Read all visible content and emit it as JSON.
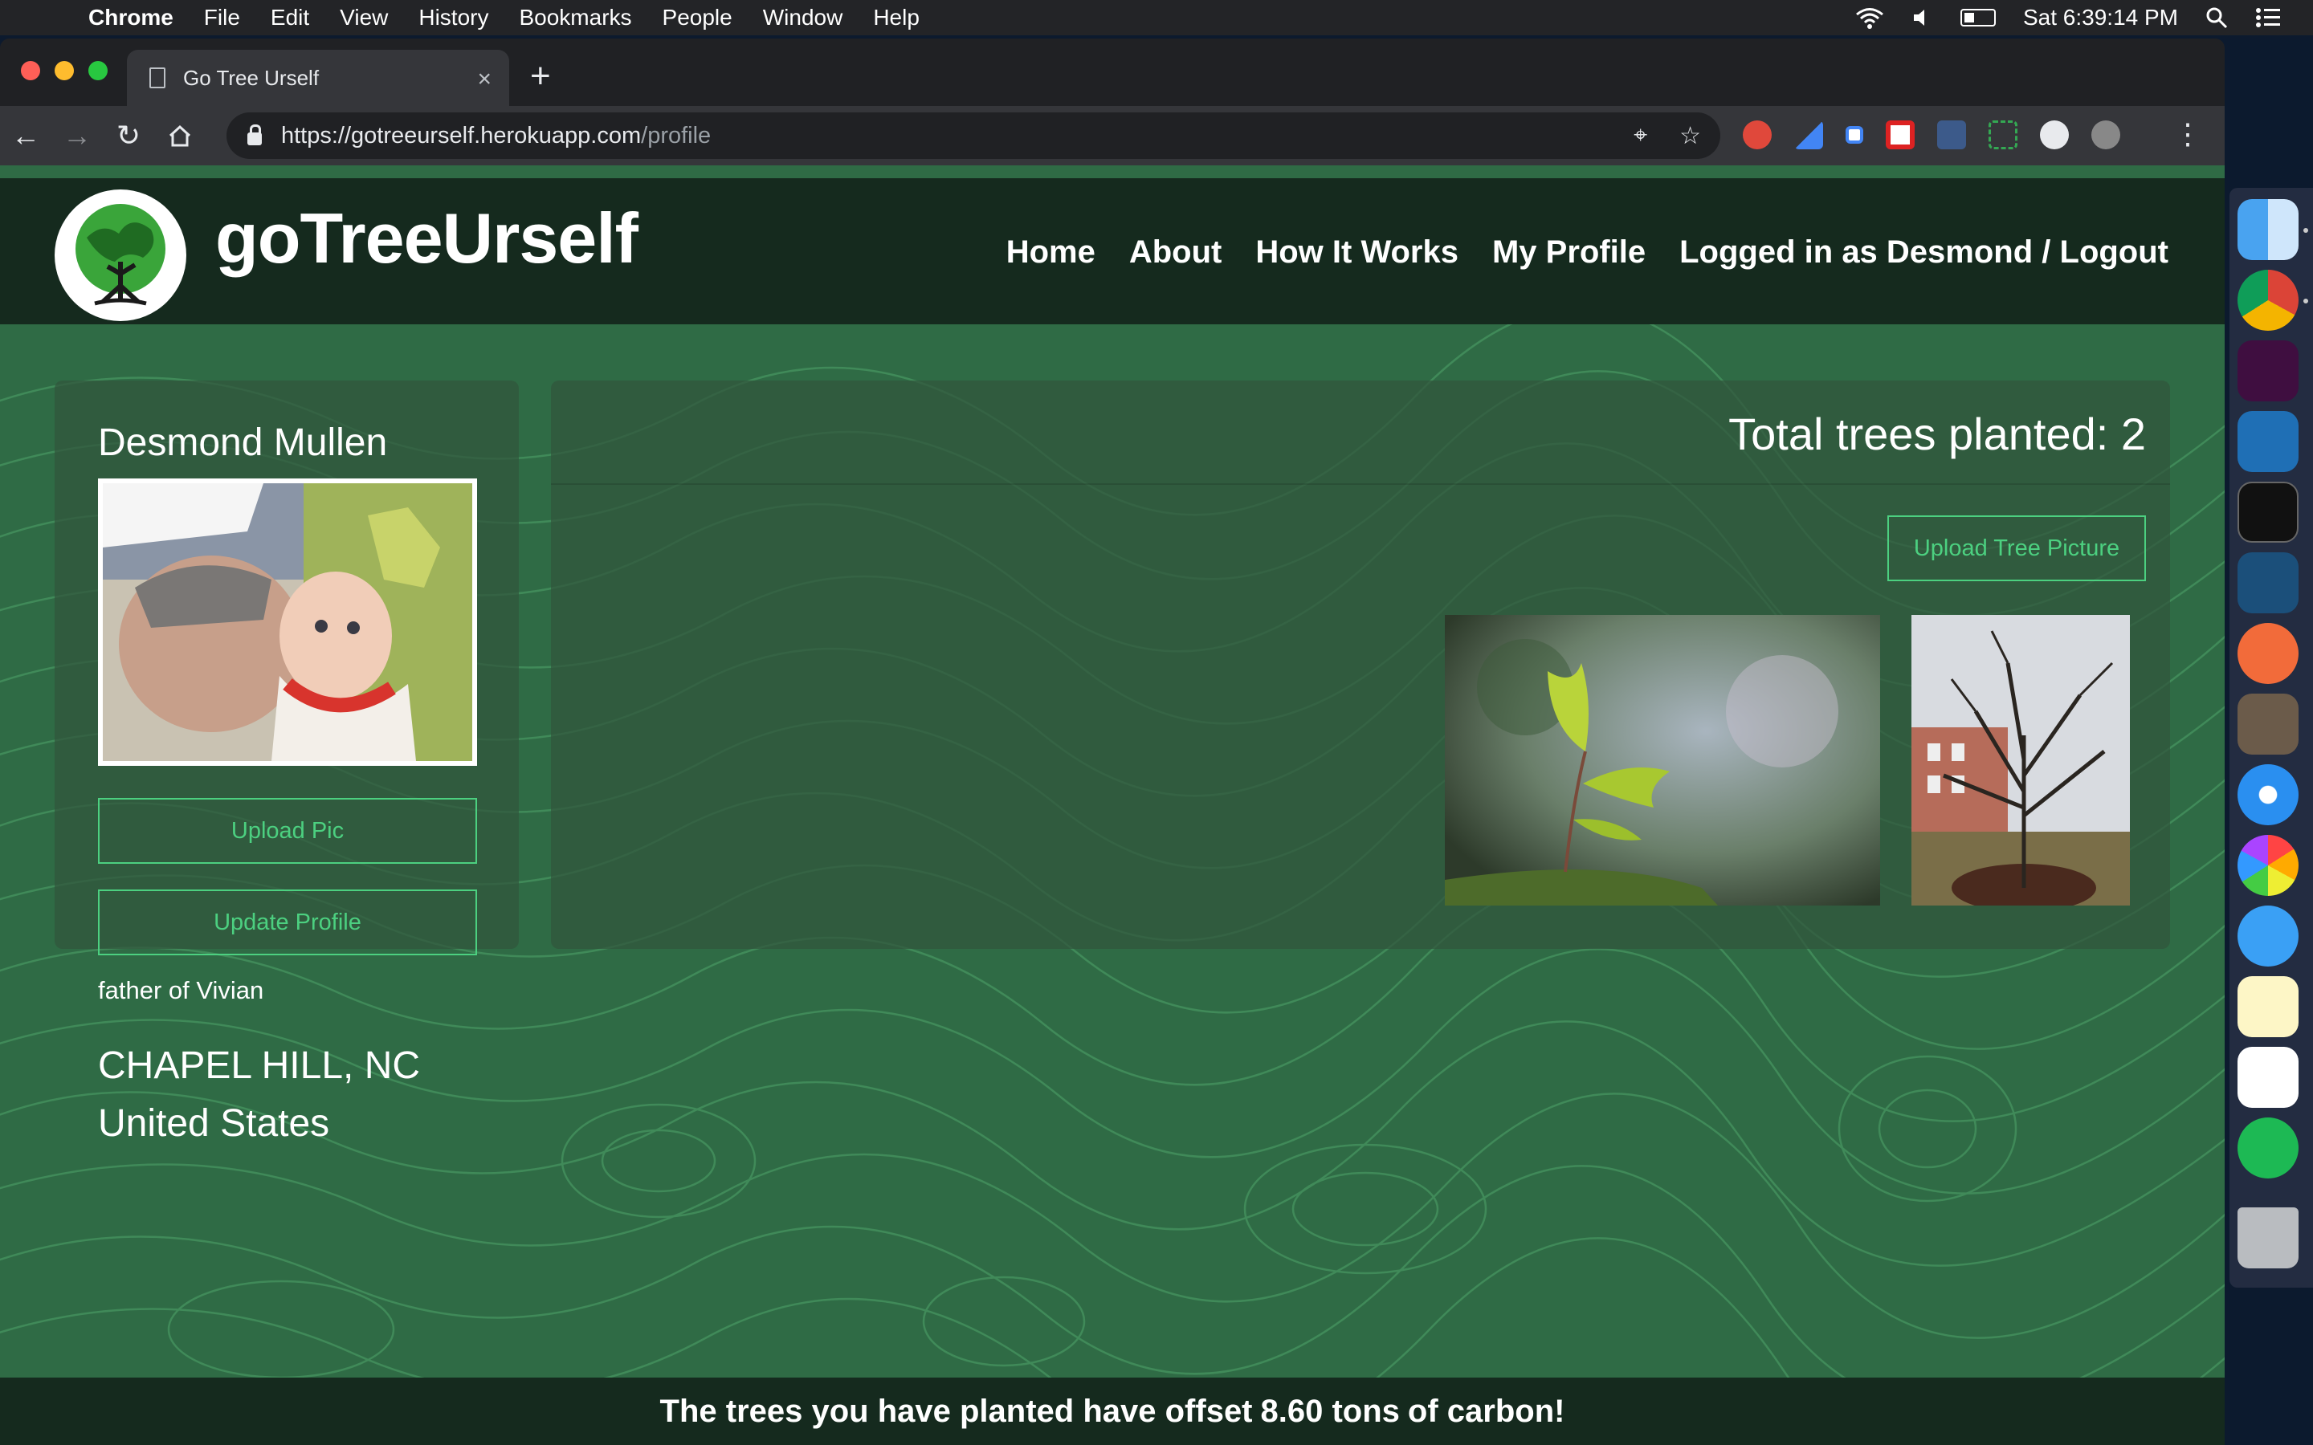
{
  "menubar": {
    "app": "Chrome",
    "items": [
      "File",
      "Edit",
      "View",
      "History",
      "Bookmarks",
      "People",
      "Window",
      "Help"
    ],
    "clock": "Sat 6:39:14 PM"
  },
  "browser": {
    "tab_title": "Go Tree Urself",
    "url_host": "https://gotreeurself.herokuapp.com",
    "url_path": "/profile"
  },
  "site": {
    "brand": "goTreeUrself",
    "nav": [
      "Home",
      "About",
      "How It Works",
      "My Profile",
      "Logged in as Desmond / Logout"
    ]
  },
  "profile": {
    "name": "Desmond Mullen",
    "upload_pic_label": "Upload Pic",
    "update_profile_label": "Update Profile",
    "bio": "father of Vivian",
    "city_state": "CHAPEL HILL, NC",
    "country": "United States"
  },
  "trees": {
    "total_label": "Total trees planted: 2",
    "upload_label": "Upload Tree Picture"
  },
  "footer": {
    "prefix": "The trees you have planted have offset",
    "amount": "8.60 tons",
    "suffix": "of carbon!"
  },
  "colors": {
    "page_bg": "#2f6b45",
    "header_bg": "#152a1e",
    "accent": "#4cd080"
  }
}
